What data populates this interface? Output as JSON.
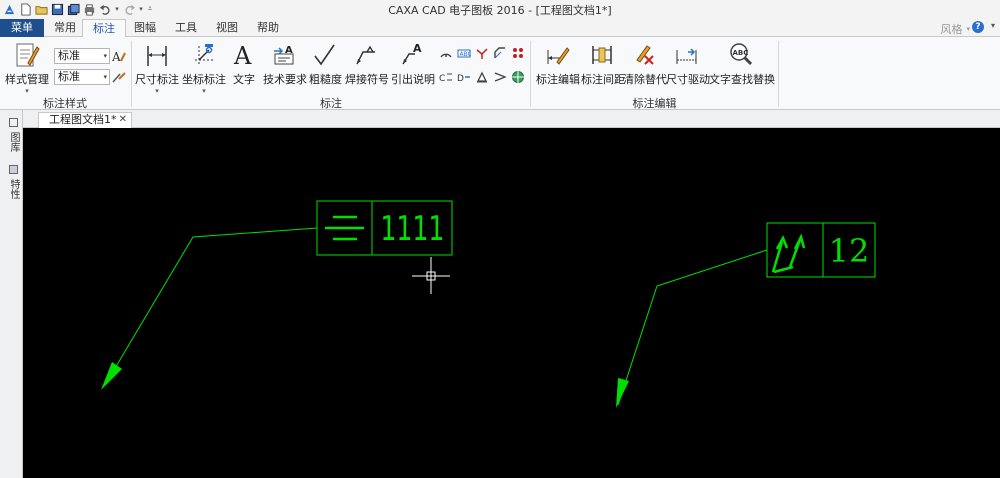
{
  "window": {
    "title": "CAXA CAD 电子图板 2016 - [工程图文档1*]"
  },
  "tabs": {
    "menu": "菜单",
    "common": "常用",
    "annotation": "标注",
    "frame": "图幅",
    "tools": "工具",
    "view": "视图",
    "help": "帮助"
  },
  "top_right": {
    "style_label": "风格"
  },
  "ribbon": {
    "groups": {
      "style": "标注样式",
      "annotate": "标注",
      "edit": "标注编辑"
    },
    "style_manager": "样式管理",
    "combo_1": "标准",
    "combo_2": "标准",
    "buttons": {
      "dimension": "尺寸标注",
      "coordinate": "坐标标注",
      "text": "文字",
      "tech_req": "技术要求",
      "roughness": "粗糙度",
      "weld": "焊接符号",
      "leader": "引出说明",
      "dim_edit": "标注编辑",
      "dim_spacing": "标注间距",
      "clear_override": "清除替代",
      "dim_drive": "尺寸驱动",
      "text_find_replace": "文字查找替换"
    }
  },
  "document_tab": "工程图文档1*",
  "side_tabs": {
    "library": "图库",
    "properties": "特性"
  },
  "drawing": {
    "tolerance_1_value": "1111",
    "tolerance_2_value": "12",
    "stroke_color": "#00e000"
  }
}
